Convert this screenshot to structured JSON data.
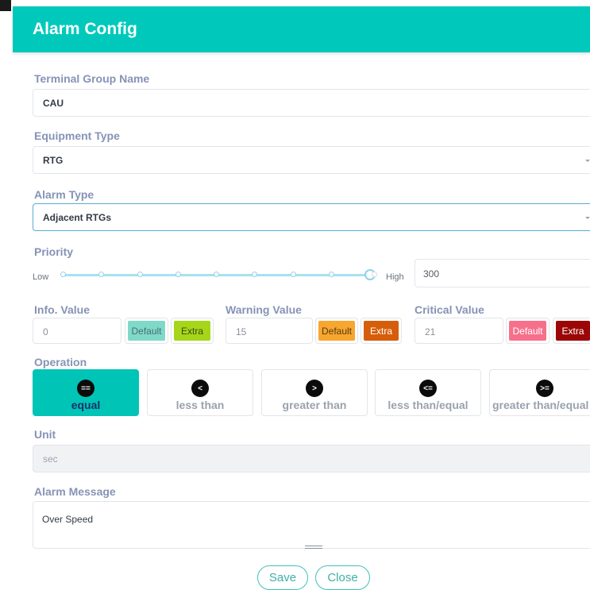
{
  "dialog": {
    "title": "Alarm Config"
  },
  "terminal_group": {
    "label": "Terminal Group Name",
    "value": "CAU"
  },
  "equipment_type": {
    "label": "Equipment Type",
    "value": "RTG"
  },
  "alarm_type": {
    "label": "Alarm Type",
    "value": "Adjacent RTGs"
  },
  "priority": {
    "label": "Priority",
    "low_label": "Low",
    "high_label": "High",
    "value": "300",
    "steps": 9,
    "selected_step": 9
  },
  "values": {
    "info": {
      "label": "Info. Value",
      "value": "0",
      "default_label": "Default",
      "extra_label": "Extra",
      "default_color": "#7fd9c9",
      "extra_color": "#a5d61a"
    },
    "warning": {
      "label": "Warning Value",
      "value": "15",
      "default_label": "Default",
      "extra_label": "Extra",
      "default_color": "#f7a630",
      "extra_color": "#d65e0a"
    },
    "critical": {
      "label": "Critical Value",
      "value": "21",
      "default_label": "Default",
      "extra_label": "Extra",
      "default_color": "#f7708b",
      "extra_color": "#9c0606"
    }
  },
  "operation": {
    "label": "Operation",
    "selected": "equal",
    "options": [
      {
        "symbol": "==",
        "label": "equal"
      },
      {
        "symbol": "<",
        "label": "less than"
      },
      {
        "symbol": ">",
        "label": "greater than"
      },
      {
        "symbol": "<=",
        "label": "less than/equal"
      },
      {
        "symbol": ">=",
        "label": "greater than/equal"
      }
    ]
  },
  "unit": {
    "label": "Unit",
    "value": "sec"
  },
  "alarm_message": {
    "label": "Alarm Message",
    "value": "Over Speed"
  },
  "footer": {
    "save_label": "Save",
    "close_label": "Close"
  },
  "colors": {
    "accent": "#00c9bc",
    "label": "#8693b5",
    "button_border": "#3fc3b9"
  }
}
